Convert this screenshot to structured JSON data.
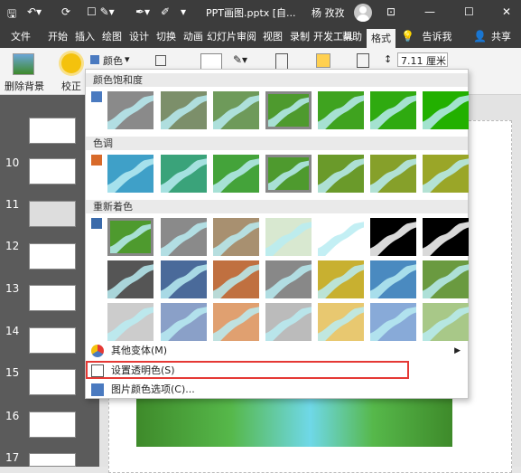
{
  "title_bar": {
    "filename": "PPT画图.pptx [自...",
    "user": "杨 孜孜",
    "share": "共享",
    "tell_me": "告诉我"
  },
  "tabs": [
    "文件",
    "开始",
    "插入",
    "绘图",
    "设计",
    "切换",
    "动画",
    "幻灯片",
    "审阅",
    "视图",
    "录制",
    "开发工具",
    "帮助",
    "格式"
  ],
  "active_tab": "格式",
  "ribbon": {
    "remove_bg": "删除背景",
    "correct": "校正",
    "color": "颜色",
    "size_value": "7.11 厘米"
  },
  "dropdown": {
    "saturation_header": "颜色饱和度",
    "tone_header": "色调",
    "recolor_header": "重新着色",
    "more_variants": "其他变体(M)",
    "set_transparent": "设置透明色(S)",
    "picture_color_options": "图片颜色选项(C)..."
  },
  "slides": [
    "10",
    "11",
    "12",
    "13",
    "14",
    "15",
    "16",
    "17"
  ],
  "saturation_tints": [
    "#8a8a8a",
    "#7c8f6a",
    "#6e9a5a",
    "#4e9a2e",
    "#3fa31f",
    "#2faa10",
    "#22b000"
  ],
  "tone_tints": [
    "#3fa0c8",
    "#3aa37a",
    "#44a33a",
    "#4e9a2e",
    "#6a9a2a",
    "#86a02a",
    "#9aa628"
  ],
  "recolor_rows": [
    [
      "#4e9a2e",
      "#8a8a8a",
      "#a89070",
      "#d8e8d0",
      "#ffffff",
      "#000000",
      "#000000"
    ],
    [
      "#555555",
      "#4a6a9a",
      "#c07040",
      "#888888",
      "#c8b030",
      "#4a8ac0",
      "#6a9a40"
    ],
    [
      "#cccccc",
      "#8aa0c8",
      "#e0a070",
      "#bbbbbb",
      "#e8c870",
      "#88aad8",
      "#a8c888"
    ]
  ],
  "colors": {
    "titlebar_bg": "#3c3c3c",
    "highlight_red": "#e53935"
  }
}
